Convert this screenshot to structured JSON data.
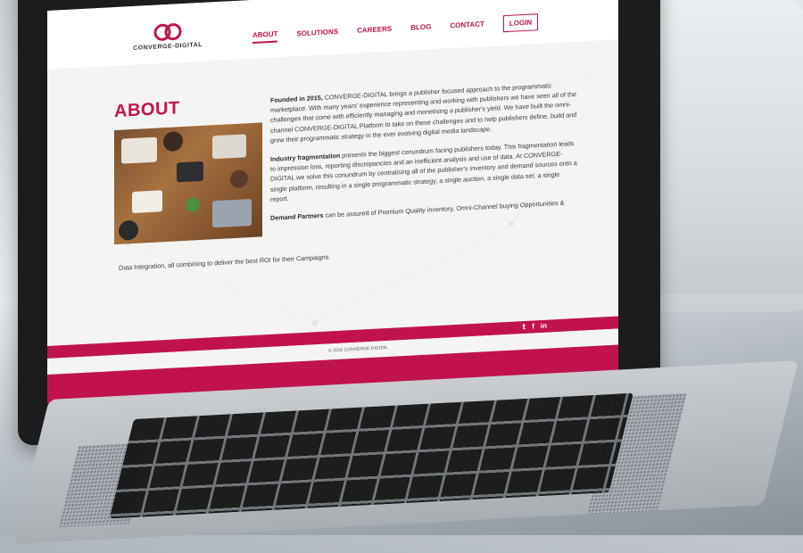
{
  "brand": {
    "name": "CONVERGE-DIGITAL",
    "color": "#c0134d"
  },
  "nav": {
    "items": [
      "ABOUT",
      "SOLUTIONS",
      "CAREERS",
      "BLOG",
      "CONTACT"
    ],
    "active": "ABOUT",
    "login_label": "LOGIN"
  },
  "page": {
    "title": "ABOUT",
    "paragraphs": [
      {
        "lead": "Founded in 2015,",
        "text": " CONVERGE-DIGITAL brings a publisher focused approach to the programmatic marketplace. With many years' experience representing and working with publishers we have seen all of the challenges that come with efficiently managing and monetising a publisher's yield. We have built the omni-channel CONVERGE-DIGITAL Platform to take on these challenges and to help publishers define, build and grow their programmatic strategy in the ever evolving digital media landscape."
      },
      {
        "lead": "Industry fragmentation",
        "text": " presents the biggest conundrum facing publishers today. This fragmentation leads to impression loss, reporting discrepancies and an inefficient analysis and use of data. At CONVERGE-DIGITAL we solve this conundrum by centralising all of the publisher's inventory and demand sources onto a single platform, resulting in a single programmatic strategy, a single auction, a single data set, a single report."
      },
      {
        "lead": "Demand Partners",
        "text": " can be assured of Premium Quality inventory, Omni-Channel buying Opportunities &"
      }
    ],
    "last_line": "Data Integration, all combining to deliver the best ROI for their Campaigns."
  },
  "footer": {
    "social": [
      "twitter-icon",
      "facebook-icon",
      "linkedin-icon"
    ],
    "social_glyphs": [
      "𝕥",
      "f",
      "in"
    ],
    "copyright": "© 2016 CONVERGE-DIGITAL"
  }
}
